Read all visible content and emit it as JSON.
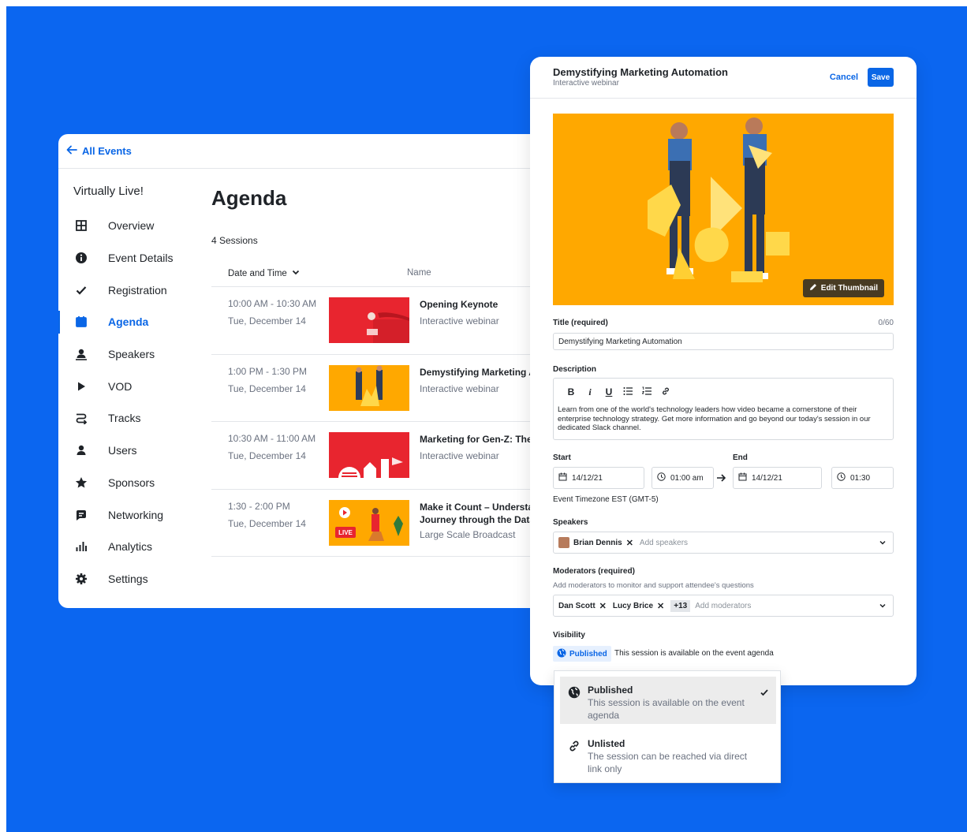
{
  "back_link": "All Events",
  "sidebar": {
    "event_name": "Virtually Live!",
    "items": [
      {
        "label": "Overview"
      },
      {
        "label": "Event Details"
      },
      {
        "label": "Registration"
      },
      {
        "label": "Agenda",
        "active": true
      },
      {
        "label": "Speakers"
      },
      {
        "label": "VOD"
      },
      {
        "label": "Tracks"
      },
      {
        "label": "Users"
      },
      {
        "label": "Sponsors"
      },
      {
        "label": "Networking"
      },
      {
        "label": "Analytics"
      },
      {
        "label": "Settings"
      }
    ]
  },
  "agenda": {
    "title": "Agenda",
    "session_count": "4 Sessions",
    "columns": [
      "Date and Time",
      "Name"
    ],
    "rows": [
      {
        "time": "10:00 AM - 10:30 AM",
        "date": "Tue, December 14",
        "name": "Opening Keynote",
        "type": "Interactive webinar"
      },
      {
        "time": "1:00 PM - 1:30 PM",
        "date": "Tue, December 14",
        "name": "Demystifying Marketing A",
        "type": "Interactive webinar"
      },
      {
        "time": "10:30 AM - 11:00 AM",
        "date": "Tue, December 14",
        "name": "Marketing for Gen-Z: The r",
        "type": "Interactive webinar"
      },
      {
        "time": "1:30 - 2:00 PM",
        "date": "Tue, December 14",
        "name": "Make it Count – Understar Journey through the Data",
        "type": "Large Scale Broadcast",
        "thumb_badge": "LIVE"
      }
    ]
  },
  "edit": {
    "title": "Demystifying Marketing Automation",
    "subtitle": "Interactive webinar",
    "cancel": "Cancel",
    "save": "Save",
    "edit_thumbnail": "Edit Thumbnail",
    "title_label": "Title (required)",
    "title_count": "0/60",
    "title_value": "Demystifying Marketing Automation",
    "description_label": "Description",
    "description": "Learn from one of the world's technology leaders how video became a cornerstone of their enterprise technology strategy. Get more information and go beyond our today's session in our dedicated Slack channel.",
    "start_label": "Start",
    "end_label": "End",
    "start_date": "14/12/21",
    "start_time": "01:00 am",
    "end_date": "14/12/21",
    "end_time": "01:30",
    "timezone": "Event Timezone EST (GMT-5)",
    "speakers_label": "Speakers",
    "speakers": [
      "Brian Dennis"
    ],
    "speakers_placeholder": "Add speakers",
    "moderators_label": "Moderators (required)",
    "moderators_hint": "Add moderators to monitor and support attendee's questions",
    "moderators": [
      "Dan Scott",
      "Lucy Brice"
    ],
    "moderators_more": "+13",
    "moderators_placeholder": "Add moderators",
    "visibility_label": "Visibility",
    "visibility_value": "Published",
    "visibility_desc": "This session is available on the event agenda"
  },
  "visibility_menu": [
    {
      "title": "Published",
      "desc": "This session is available on the event agenda",
      "selected": true,
      "icon": "globe-icon"
    },
    {
      "title": "Unlisted",
      "desc": "The session can be reached via direct link only",
      "selected": false,
      "icon": "link-icon"
    }
  ],
  "colors": {
    "background": "#0b66f0",
    "accent": "#0a66e6",
    "thumbnail_orange": "#ffa800",
    "thumbnail_red": "#e8252f"
  }
}
